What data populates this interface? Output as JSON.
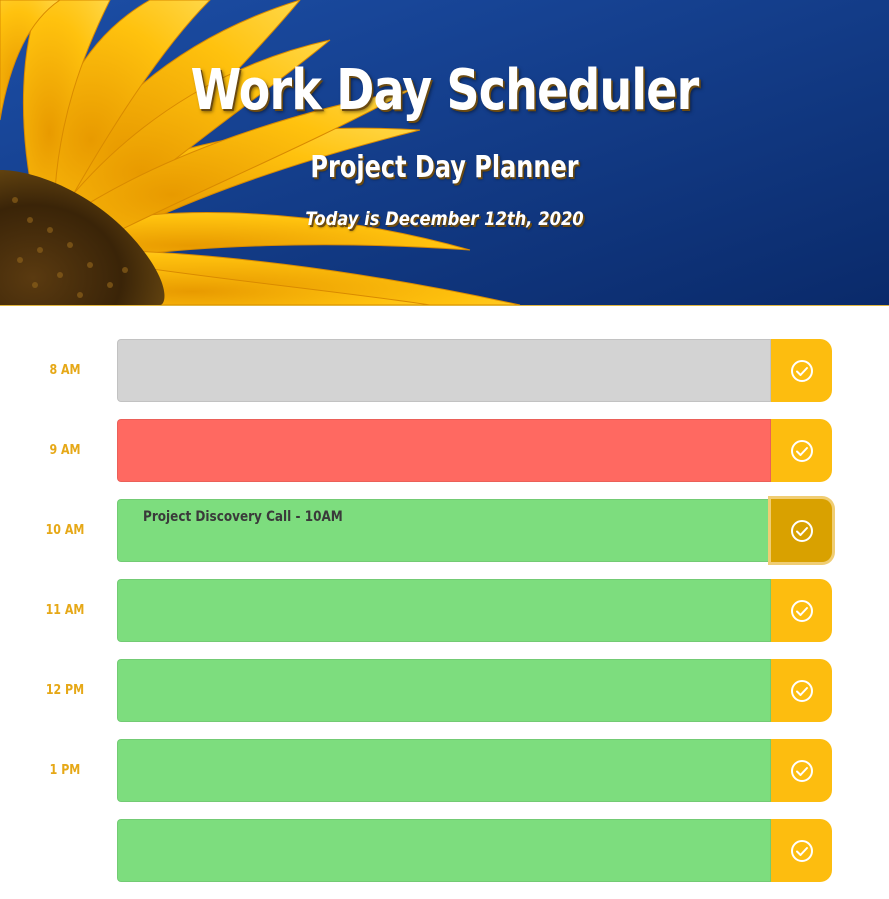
{
  "header": {
    "title": "Work Day Scheduler",
    "subtitle": "Project Day Planner",
    "date_text": "Today is December 12th, 2020"
  },
  "colors": {
    "past": "#d3d3d3",
    "present": "#ff6961",
    "future": "#7ddd7e",
    "save_button": "#fdbd0f",
    "hour_label": "#e6a817",
    "hero_background": "#0f3c8f"
  },
  "schedule": {
    "rows": [
      {
        "hour": "8 AM",
        "status": "past",
        "entry": "",
        "save_icon": "check-circle-icon"
      },
      {
        "hour": "9 AM",
        "status": "present",
        "entry": "",
        "save_icon": "check-circle-icon"
      },
      {
        "hour": "10 AM",
        "status": "future",
        "entry": "Project Discovery Call - 10AM",
        "save_icon": "check-circle-icon"
      },
      {
        "hour": "11 AM",
        "status": "future",
        "entry": "",
        "save_icon": "check-circle-icon"
      },
      {
        "hour": "12 PM",
        "status": "future",
        "entry": "",
        "save_icon": "check-circle-icon"
      },
      {
        "hour": "1 PM",
        "status": "future",
        "entry": "",
        "save_icon": "check-circle-icon"
      },
      {
        "hour": "",
        "status": "future",
        "entry": "",
        "save_icon": "check-circle-icon"
      }
    ]
  }
}
